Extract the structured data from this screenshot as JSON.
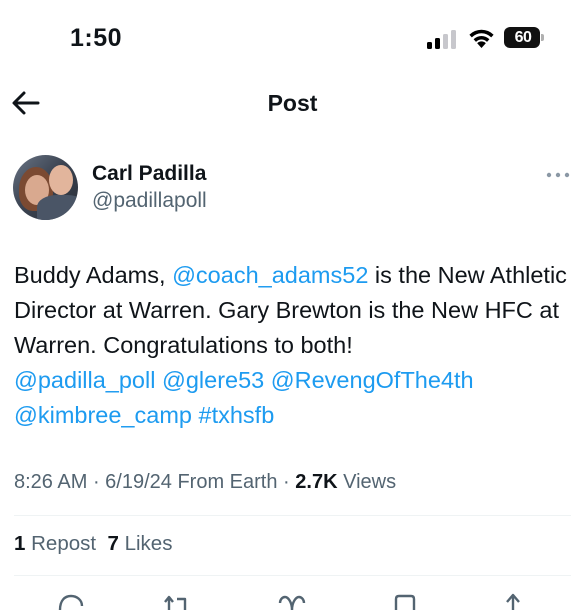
{
  "status_bar": {
    "time": "1:50",
    "battery_level": "60"
  },
  "header": {
    "back_icon": "arrow-left-icon",
    "title": "Post"
  },
  "author": {
    "name": "Carl Padilla",
    "handle": "@padillapoll",
    "more_icon": "more-horizontal-icon"
  },
  "tweet": {
    "text_1": "Buddy Adams, ",
    "mention_1": "@coach_adams52",
    "text_2": " is the New Athletic Director at Warren. Gary Brewton is the New HFC at Warren. Congratulations to both! ",
    "mention_2": "@padilla_poll",
    "mention_3": "@glere53",
    "mention_4": "@RevengOfThe4th",
    "mention_5": "@kimbree_camp",
    "hashtag_1": "#txhsfb"
  },
  "meta": {
    "time": "8:26 AM",
    "date": "6/19/24",
    "source": "From Earth",
    "views_count": "2.7K",
    "views_label": "Views"
  },
  "stats": {
    "reposts_count": "1",
    "reposts_label": "Repost",
    "likes_count": "7",
    "likes_label": "Likes"
  },
  "actions": {
    "icons": [
      "reply-icon",
      "repost-icon",
      "like-icon",
      "bookmark-icon",
      "share-icon"
    ]
  },
  "colors": {
    "link": "#1d9bf0",
    "secondary_text": "#536471",
    "primary_text": "#0f1419",
    "divider": "#eff3f4"
  }
}
